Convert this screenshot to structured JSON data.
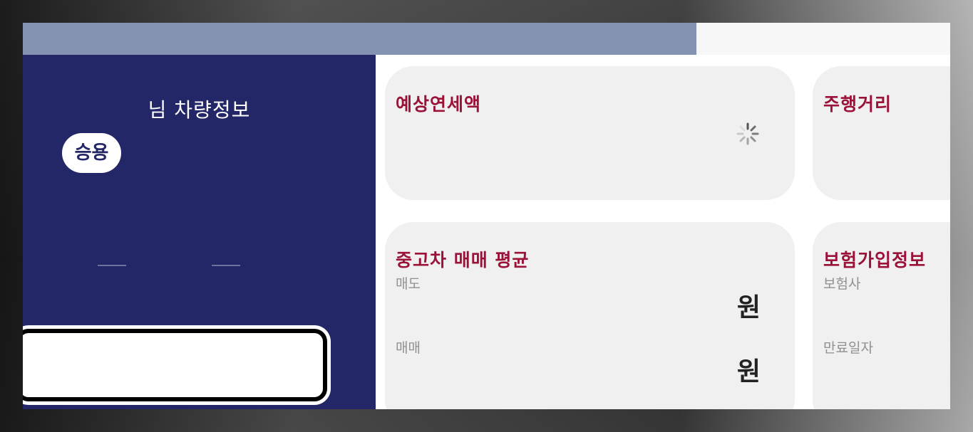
{
  "vehicle_panel": {
    "owner_title": "님 차량정보",
    "type_badge": "승용"
  },
  "cards": {
    "annual_tax": {
      "title": "예상연세액"
    },
    "mileage": {
      "title": "주행거리"
    },
    "used_car_average": {
      "title": "중고차 매매 평균",
      "sell_label": "매도",
      "sell_unit": "원",
      "trade_label": "매매",
      "trade_unit": "원"
    },
    "insurance": {
      "title": "보험가입정보",
      "insurer_label": "보험사",
      "expiry_label": "만료일자"
    }
  },
  "icons": {
    "loading": "loading-spinner-icon"
  },
  "colors": {
    "panel_navy": "#242767",
    "top_bar": "#8593b2",
    "card_title": "#9a1238",
    "card_bg": "#f0f0f0"
  }
}
